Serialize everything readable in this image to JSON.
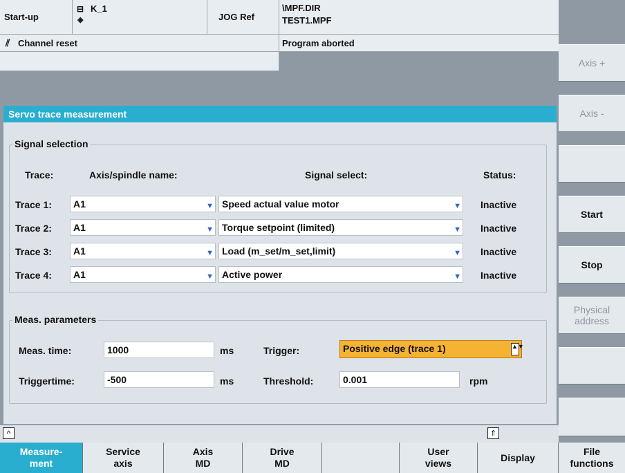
{
  "header": {
    "mode": "Start-up",
    "channel": "K_1",
    "jog": "JOG Ref",
    "path_line1": "\\MPF.DIR",
    "path_line2": "TEST1.MPF",
    "channel_status": "Channel reset",
    "program_status": "Program aborted"
  },
  "vertical_softkeys": [
    "Axis +",
    "Axis -",
    "",
    "Start",
    "Stop",
    "Physical address",
    "",
    ""
  ],
  "vertical_softkeys_disabled": [
    true,
    true,
    false,
    false,
    false,
    true,
    false,
    false
  ],
  "window": {
    "title": "Servo trace measurement"
  },
  "signal_selection": {
    "label": "Signal selection",
    "col_trace": "Trace:",
    "col_axis": "Axis/spindle name:",
    "col_signal": "Signal select:",
    "col_status": "Status:",
    "traces": [
      {
        "label": "Trace 1:",
        "axis": "A1",
        "signal": "Speed actual value motor",
        "status": "Inactive"
      },
      {
        "label": "Trace 2:",
        "axis": "A1",
        "signal": "Torque setpoint (limited)",
        "status": "Inactive"
      },
      {
        "label": "Trace 3:",
        "axis": "A1",
        "signal": "Load (m_set/m_set,limit)",
        "status": "Inactive"
      },
      {
        "label": "Trace 4:",
        "axis": "A1",
        "signal": "Active power",
        "status": "Inactive"
      }
    ]
  },
  "meas_params": {
    "label": "Meas. parameters",
    "meas_time_label": "Meas. time:",
    "meas_time": "1000",
    "meas_time_unit": "ms",
    "triggertime_label": "Triggertime:",
    "triggertime": "-500",
    "triggertime_unit": "ms",
    "trigger_label": "Trigger:",
    "trigger_value": "Positive edge (trace 1)",
    "threshold_label": "Threshold:",
    "threshold": "0.001",
    "threshold_unit": "rpm"
  },
  "bottom_softkeys": [
    "Measure-\nment",
    "Service\naxis",
    "Axis\nMD",
    "Drive\nMD",
    "",
    "User\nviews",
    "Display",
    "File\nfunctions"
  ],
  "colors": {
    "accent": "#2aaed0",
    "highlight": "#f5b233",
    "background": "#8e99a3"
  }
}
